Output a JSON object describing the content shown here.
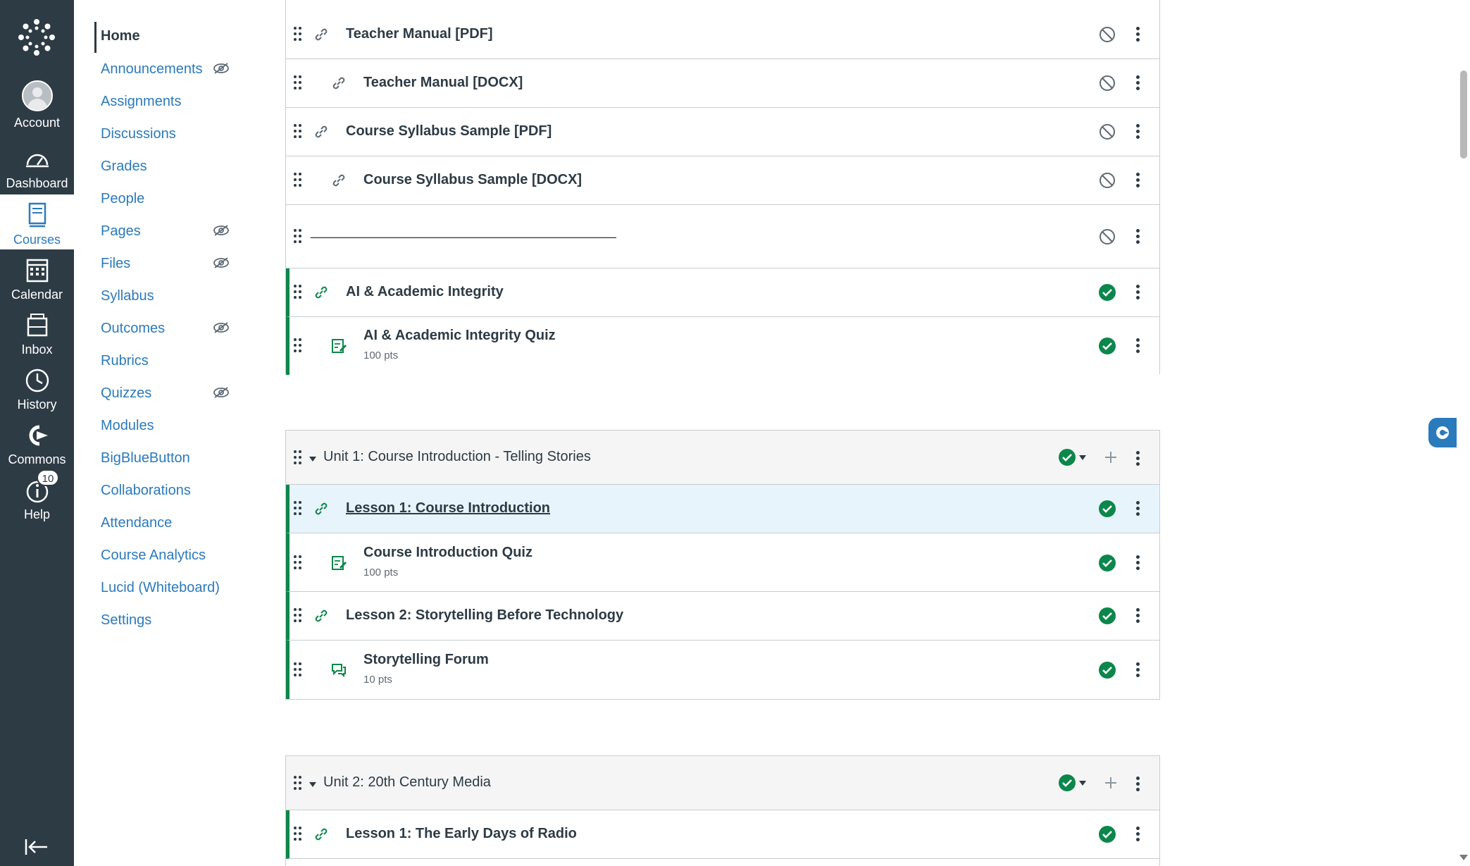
{
  "global_nav": {
    "items": [
      {
        "label": "Account",
        "icon": "avatar"
      },
      {
        "label": "Dashboard",
        "icon": "dashboard-icon"
      },
      {
        "label": "Courses",
        "icon": "courses-icon",
        "active": true
      },
      {
        "label": "Calendar",
        "icon": "calendar-icon"
      },
      {
        "label": "Inbox",
        "icon": "inbox-icon"
      },
      {
        "label": "History",
        "icon": "history-icon"
      },
      {
        "label": "Commons",
        "icon": "commons-icon"
      },
      {
        "label": "Help",
        "icon": "help-icon",
        "badge": "10"
      }
    ]
  },
  "course_nav": {
    "items": [
      {
        "label": "Home",
        "active": true
      },
      {
        "label": "Announcements",
        "hidden_from_students": true
      },
      {
        "label": "Assignments"
      },
      {
        "label": "Discussions"
      },
      {
        "label": "Grades"
      },
      {
        "label": "People"
      },
      {
        "label": "Pages",
        "hidden_from_students": true
      },
      {
        "label": "Files",
        "hidden_from_students": true
      },
      {
        "label": "Syllabus"
      },
      {
        "label": "Outcomes",
        "hidden_from_students": true
      },
      {
        "label": "Rubrics"
      },
      {
        "label": "Quizzes",
        "hidden_from_students": true
      },
      {
        "label": "Modules"
      },
      {
        "label": "BigBlueButton"
      },
      {
        "label": "Collaborations"
      },
      {
        "label": "Attendance"
      },
      {
        "label": "Course Analytics"
      },
      {
        "label": "Lucid (Whiteboard)"
      },
      {
        "label": "Settings"
      }
    ]
  },
  "modules": {
    "module0": {
      "items": [
        {
          "title": "Teacher Manual [PDF]",
          "type": "link",
          "indent": 0,
          "status": "unpublished"
        },
        {
          "title": "Teacher Manual [DOCX]",
          "type": "link",
          "indent": 1,
          "status": "unpublished"
        },
        {
          "title": "Course Syllabus Sample [PDF]",
          "type": "link",
          "indent": 0,
          "status": "unpublished"
        },
        {
          "title": "Course Syllabus Sample [DOCX]",
          "type": "link",
          "indent": 1,
          "status": "unpublished"
        },
        {
          "title": "_______________________________________",
          "type": "subheader",
          "indent": 0,
          "status": "unpublished"
        },
        {
          "title": "AI & Academic Integrity",
          "type": "link",
          "indent": 0,
          "status": "published"
        },
        {
          "title": "AI & Academic Integrity Quiz",
          "type": "quiz",
          "indent": 1,
          "status": "published",
          "points": "100 pts"
        }
      ]
    },
    "module1": {
      "title": "Unit 1: Course Introduction - Telling Stories",
      "status": "published",
      "items": [
        {
          "title": "Lesson 1: Course Introduction",
          "type": "link",
          "indent": 0,
          "status": "published"
        },
        {
          "title": "Course Introduction Quiz",
          "type": "quiz",
          "indent": 1,
          "status": "published",
          "points": "100 pts"
        },
        {
          "title": "Lesson 2: Storytelling Before Technology",
          "type": "link",
          "indent": 0,
          "status": "published"
        },
        {
          "title": "Storytelling Forum",
          "type": "discussion",
          "indent": 1,
          "status": "published",
          "points": "10 pts"
        }
      ]
    },
    "module2": {
      "title": "Unit 2: 20th Century Media",
      "status": "published",
      "items": [
        {
          "title": "Lesson 1: The Early Days of Radio",
          "type": "link",
          "indent": 0,
          "status": "published"
        }
      ]
    }
  },
  "colors": {
    "nav_bg": "#2d3b45",
    "link": "#2b7abc",
    "published": "#0b874b",
    "unpublished": "#5f6a73",
    "highlight": "#e7f4fb"
  }
}
